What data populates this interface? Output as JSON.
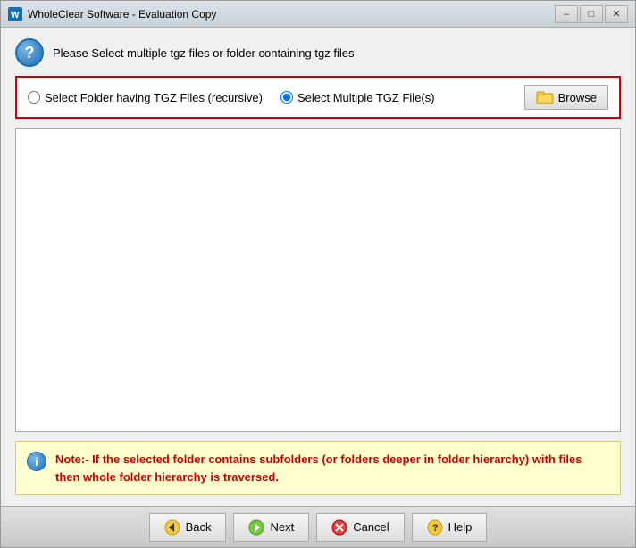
{
  "window": {
    "title": "WholeClear Software - Evaluation Copy",
    "icon": "app-icon"
  },
  "titlebar": {
    "minimize_label": "–",
    "maximize_label": "□",
    "close_label": "✕"
  },
  "header": {
    "text": "Please Select multiple tgz files or folder containing tgz files"
  },
  "options": {
    "option1_label": "Select Folder having TGZ Files (recursive)",
    "option2_label": "Select Multiple TGZ File(s)",
    "browse_label": "Browse"
  },
  "note": {
    "text": "Note:- If the selected folder contains subfolders (or folders deeper in folder hierarchy) with files then whole folder hierarchy is traversed."
  },
  "footer": {
    "back_label": "Back",
    "next_label": "Next",
    "cancel_label": "Cancel",
    "help_label": "Help"
  }
}
